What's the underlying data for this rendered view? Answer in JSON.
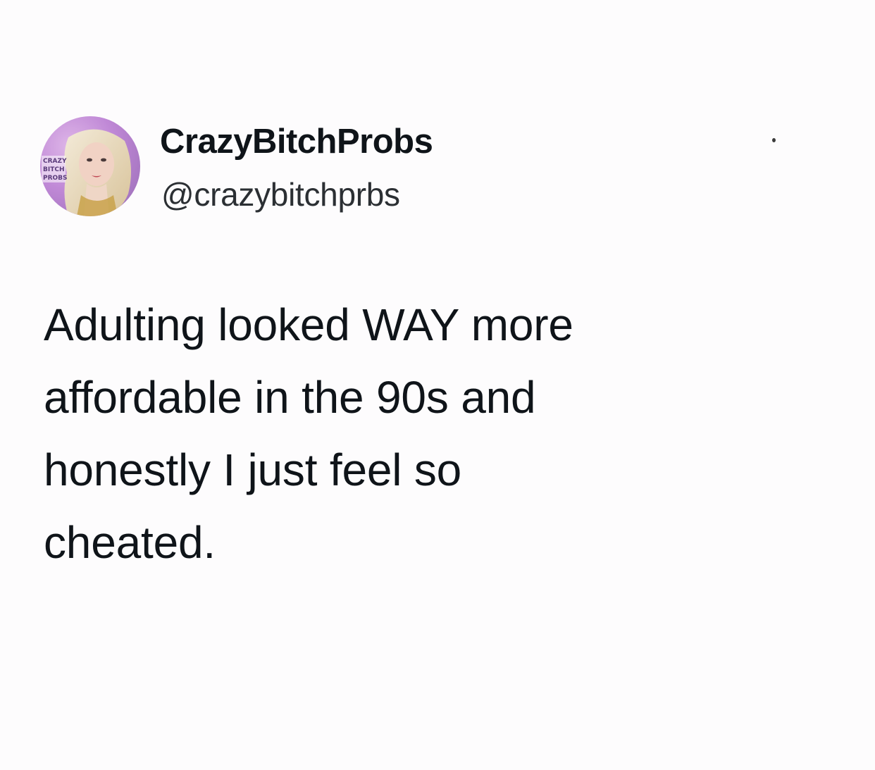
{
  "tweet": {
    "display_name": "CrazyBitchProbs",
    "handle": "@crazybitchprbs",
    "text_lines": [
      "Adulting looked WAY more",
      "affordable in the 90s and",
      "honestly I just feel so",
      "cheated."
    ],
    "avatar_logo_text": [
      "CRAZY",
      "BITCH",
      "PROBS"
    ]
  },
  "colors": {
    "background": "#fdfcfd",
    "text_primary": "#0f1419",
    "text_secondary": "#2b2f33",
    "avatar_accent": "#b069d6"
  },
  "icons": {
    "avatar": "profile-avatar",
    "more_menu": "more-options-icon"
  }
}
